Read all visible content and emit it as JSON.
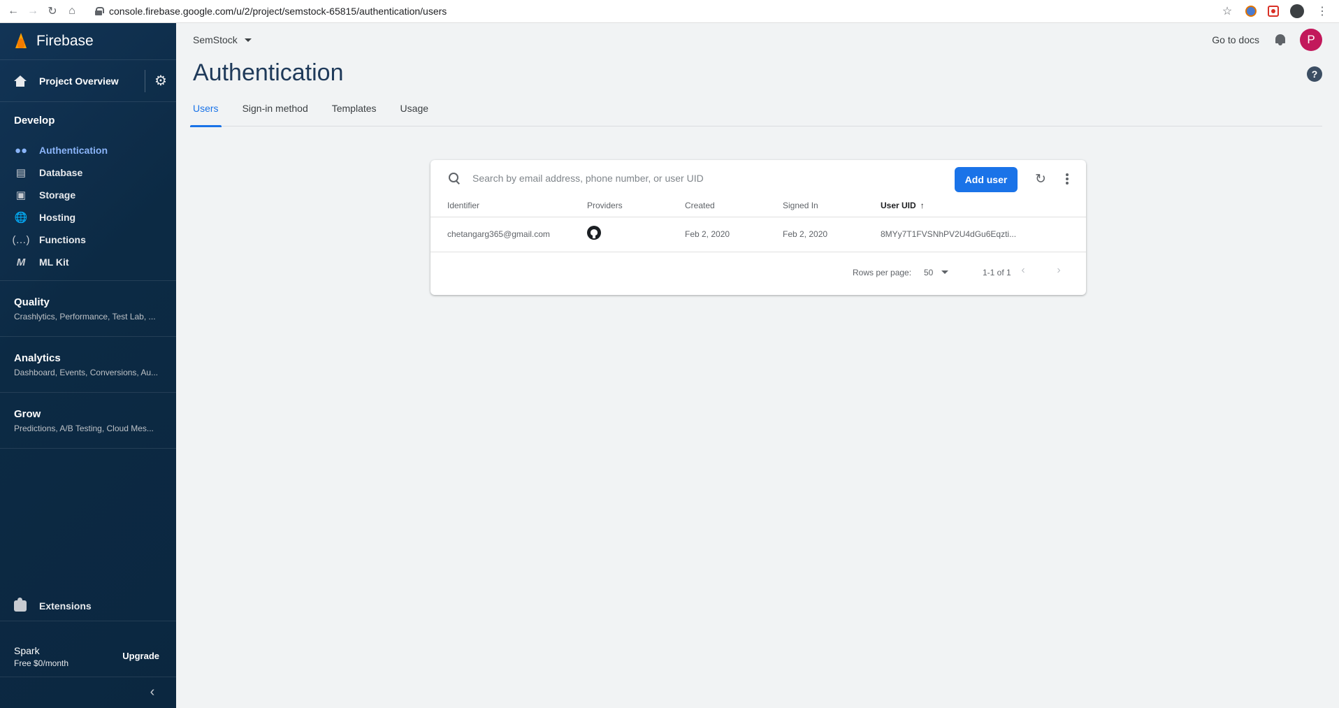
{
  "browser": {
    "url": "console.firebase.google.com/u/2/project/semstock-65815/authentication/users"
  },
  "sidebar": {
    "brand": "Firebase",
    "project_overview": "Project Overview",
    "develop": {
      "title": "Develop",
      "items": [
        {
          "label": "Authentication",
          "icon": "people-icon",
          "active": true
        },
        {
          "label": "Database",
          "icon": "database-icon"
        },
        {
          "label": "Storage",
          "icon": "storage-icon"
        },
        {
          "label": "Hosting",
          "icon": "hosting-icon"
        },
        {
          "label": "Functions",
          "icon": "functions-icon"
        },
        {
          "label": "ML Kit",
          "icon": "mlkit-icon"
        }
      ]
    },
    "groups": [
      {
        "title": "Quality",
        "subtitle": "Crashlytics, Performance, Test Lab, ..."
      },
      {
        "title": "Analytics",
        "subtitle": "Dashboard, Events, Conversions, Au..."
      },
      {
        "title": "Grow",
        "subtitle": "Predictions, A/B Testing, Cloud Mes..."
      }
    ],
    "extensions": "Extensions",
    "plan": {
      "name": "Spark",
      "price": "Free $0/month",
      "upgrade": "Upgrade"
    }
  },
  "topbar": {
    "project": "SemStock",
    "docs": "Go to docs",
    "avatar_letter": "P"
  },
  "page": {
    "title": "Authentication",
    "help": "?",
    "tabs": [
      {
        "label": "Users",
        "active": true
      },
      {
        "label": "Sign-in method"
      },
      {
        "label": "Templates"
      },
      {
        "label": "Usage"
      }
    ]
  },
  "users_table": {
    "search_placeholder": "Search by email address, phone number, or user UID",
    "add_user": "Add user",
    "columns": [
      "Identifier",
      "Providers",
      "Created",
      "Signed In",
      "User UID"
    ],
    "sorted_column": "User UID",
    "rows": [
      {
        "identifier": "chetangarg365@gmail.com",
        "provider": "github-icon",
        "created": "Feb 2, 2020",
        "signed_in": "Feb 2, 2020",
        "uid": "8MYy7T1FVSNhPV2U4dGu6Eqzti..."
      }
    ],
    "rows_per_page_label": "Rows per page:",
    "rows_per_page": "50",
    "range": "1-1 of 1"
  },
  "colors": {
    "sidebar_bg": "#0e2e4a",
    "accent": "#1a73e8",
    "active_nav": "#8ab4f8",
    "avatar": "#c2185b"
  }
}
